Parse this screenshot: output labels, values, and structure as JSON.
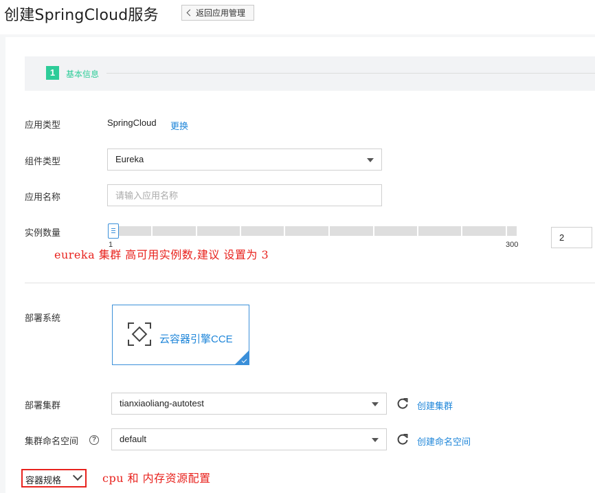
{
  "header": {
    "title": "创建SpringCloud服务",
    "back_label": "返回应用管理"
  },
  "step": {
    "number": "1",
    "label": "基本信息"
  },
  "form": {
    "app_type": {
      "label": "应用类型",
      "value": "SpringCloud",
      "change_link": "更换"
    },
    "component_type": {
      "label": "组件类型",
      "value": "Eureka"
    },
    "app_name": {
      "label": "应用名称",
      "value": "",
      "placeholder": "请输入应用名称"
    },
    "instance_count": {
      "label": "实例数量",
      "min_label": "1",
      "max_label": "300",
      "value": "2",
      "slider_fraction": 0.0
    },
    "deploy_system": {
      "label": "部署系统",
      "option_label": "云容器引擎CCE"
    },
    "deploy_cluster": {
      "label": "部署集群",
      "value": "tianxiaoliang-autotest",
      "create_link": "创建集群"
    },
    "namespace": {
      "label": "集群命名空间",
      "value": "default",
      "create_link": "创建命名空间",
      "help": "?"
    },
    "container_spec": {
      "label": "容器规格"
    }
  },
  "annotations": {
    "instances_note": "eureka 集群 高可用实例数,建议 设置为 3",
    "spec_note": "cpu 和 内存资源配置"
  },
  "colors": {
    "accent": "#1f86d9",
    "step_green": "#2ecc99",
    "annotation_red": "#e8221d"
  },
  "icons": {
    "back": "chevron-left-icon",
    "dropdown": "caret-down-icon",
    "refresh": "refresh-icon",
    "help": "help-circle-icon",
    "cce": "container-engine-icon",
    "selected": "check-icon",
    "expand": "chevron-down-icon"
  }
}
